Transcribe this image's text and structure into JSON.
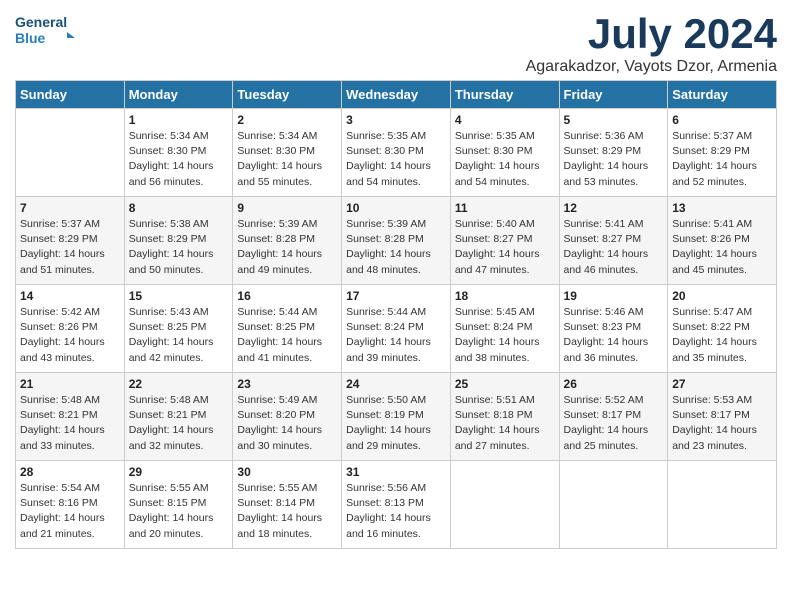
{
  "logo": {
    "line1": "General",
    "line2": "Blue"
  },
  "title": "July 2024",
  "subtitle": "Agarakadzor, Vayots Dzor, Armenia",
  "days_header": [
    "Sunday",
    "Monday",
    "Tuesday",
    "Wednesday",
    "Thursday",
    "Friday",
    "Saturday"
  ],
  "weeks": [
    [
      {
        "day": "",
        "content": ""
      },
      {
        "day": "1",
        "content": "Sunrise: 5:34 AM\nSunset: 8:30 PM\nDaylight: 14 hours\nand 56 minutes."
      },
      {
        "day": "2",
        "content": "Sunrise: 5:34 AM\nSunset: 8:30 PM\nDaylight: 14 hours\nand 55 minutes."
      },
      {
        "day": "3",
        "content": "Sunrise: 5:35 AM\nSunset: 8:30 PM\nDaylight: 14 hours\nand 54 minutes."
      },
      {
        "day": "4",
        "content": "Sunrise: 5:35 AM\nSunset: 8:30 PM\nDaylight: 14 hours\nand 54 minutes."
      },
      {
        "day": "5",
        "content": "Sunrise: 5:36 AM\nSunset: 8:29 PM\nDaylight: 14 hours\nand 53 minutes."
      },
      {
        "day": "6",
        "content": "Sunrise: 5:37 AM\nSunset: 8:29 PM\nDaylight: 14 hours\nand 52 minutes."
      }
    ],
    [
      {
        "day": "7",
        "content": "Sunrise: 5:37 AM\nSunset: 8:29 PM\nDaylight: 14 hours\nand 51 minutes."
      },
      {
        "day": "8",
        "content": "Sunrise: 5:38 AM\nSunset: 8:29 PM\nDaylight: 14 hours\nand 50 minutes."
      },
      {
        "day": "9",
        "content": "Sunrise: 5:39 AM\nSunset: 8:28 PM\nDaylight: 14 hours\nand 49 minutes."
      },
      {
        "day": "10",
        "content": "Sunrise: 5:39 AM\nSunset: 8:28 PM\nDaylight: 14 hours\nand 48 minutes."
      },
      {
        "day": "11",
        "content": "Sunrise: 5:40 AM\nSunset: 8:27 PM\nDaylight: 14 hours\nand 47 minutes."
      },
      {
        "day": "12",
        "content": "Sunrise: 5:41 AM\nSunset: 8:27 PM\nDaylight: 14 hours\nand 46 minutes."
      },
      {
        "day": "13",
        "content": "Sunrise: 5:41 AM\nSunset: 8:26 PM\nDaylight: 14 hours\nand 45 minutes."
      }
    ],
    [
      {
        "day": "14",
        "content": "Sunrise: 5:42 AM\nSunset: 8:26 PM\nDaylight: 14 hours\nand 43 minutes."
      },
      {
        "day": "15",
        "content": "Sunrise: 5:43 AM\nSunset: 8:25 PM\nDaylight: 14 hours\nand 42 minutes."
      },
      {
        "day": "16",
        "content": "Sunrise: 5:44 AM\nSunset: 8:25 PM\nDaylight: 14 hours\nand 41 minutes."
      },
      {
        "day": "17",
        "content": "Sunrise: 5:44 AM\nSunset: 8:24 PM\nDaylight: 14 hours\nand 39 minutes."
      },
      {
        "day": "18",
        "content": "Sunrise: 5:45 AM\nSunset: 8:24 PM\nDaylight: 14 hours\nand 38 minutes."
      },
      {
        "day": "19",
        "content": "Sunrise: 5:46 AM\nSunset: 8:23 PM\nDaylight: 14 hours\nand 36 minutes."
      },
      {
        "day": "20",
        "content": "Sunrise: 5:47 AM\nSunset: 8:22 PM\nDaylight: 14 hours\nand 35 minutes."
      }
    ],
    [
      {
        "day": "21",
        "content": "Sunrise: 5:48 AM\nSunset: 8:21 PM\nDaylight: 14 hours\nand 33 minutes."
      },
      {
        "day": "22",
        "content": "Sunrise: 5:48 AM\nSunset: 8:21 PM\nDaylight: 14 hours\nand 32 minutes."
      },
      {
        "day": "23",
        "content": "Sunrise: 5:49 AM\nSunset: 8:20 PM\nDaylight: 14 hours\nand 30 minutes."
      },
      {
        "day": "24",
        "content": "Sunrise: 5:50 AM\nSunset: 8:19 PM\nDaylight: 14 hours\nand 29 minutes."
      },
      {
        "day": "25",
        "content": "Sunrise: 5:51 AM\nSunset: 8:18 PM\nDaylight: 14 hours\nand 27 minutes."
      },
      {
        "day": "26",
        "content": "Sunrise: 5:52 AM\nSunset: 8:17 PM\nDaylight: 14 hours\nand 25 minutes."
      },
      {
        "day": "27",
        "content": "Sunrise: 5:53 AM\nSunset: 8:17 PM\nDaylight: 14 hours\nand 23 minutes."
      }
    ],
    [
      {
        "day": "28",
        "content": "Sunrise: 5:54 AM\nSunset: 8:16 PM\nDaylight: 14 hours\nand 21 minutes."
      },
      {
        "day": "29",
        "content": "Sunrise: 5:55 AM\nSunset: 8:15 PM\nDaylight: 14 hours\nand 20 minutes."
      },
      {
        "day": "30",
        "content": "Sunrise: 5:55 AM\nSunset: 8:14 PM\nDaylight: 14 hours\nand 18 minutes."
      },
      {
        "day": "31",
        "content": "Sunrise: 5:56 AM\nSunset: 8:13 PM\nDaylight: 14 hours\nand 16 minutes."
      },
      {
        "day": "",
        "content": ""
      },
      {
        "day": "",
        "content": ""
      },
      {
        "day": "",
        "content": ""
      }
    ]
  ]
}
